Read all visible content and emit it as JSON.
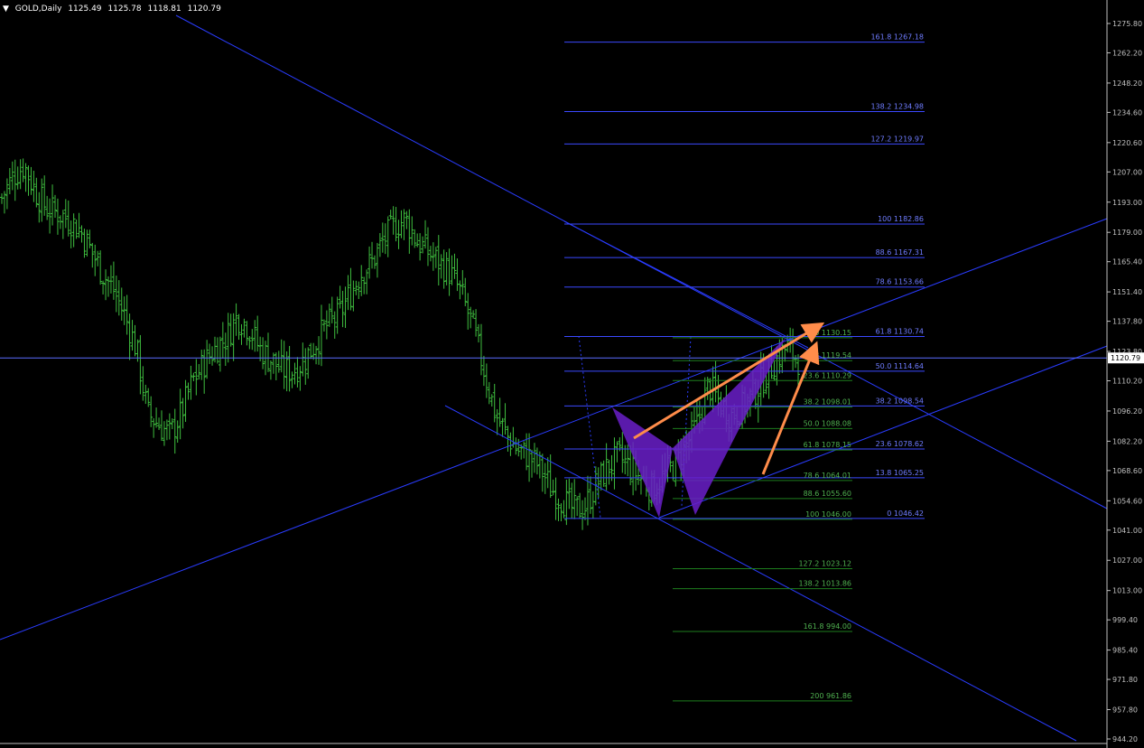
{
  "header": {
    "symbol": "GOLD,Daily",
    "open": "1125.49",
    "high": "1125.78",
    "low": "1118.81",
    "close": "1120.79",
    "caret_icon": "triangle-down-icon"
  },
  "colors": {
    "background": "#000000",
    "bar": "#3fbf3f",
    "trendline": "#2a3cff",
    "fib_blue": "#3b49ff",
    "fib_green": "#1e7e1e",
    "pattern_fill": "#6a1fc9",
    "arrow": "#ff8c4a",
    "axis": "#c0c0c0",
    "price_tag_bg": "#ffffff"
  },
  "chart_data": {
    "type": "ohlc",
    "instrument": "GOLD",
    "timeframe": "Daily",
    "ylim": [
      944.2,
      1282.0
    ],
    "y_ticks": [
      "1275.80",
      "1262.20",
      "1248.20",
      "1234.60",
      "1220.60",
      "1207.00",
      "1193.00",
      "1179.00",
      "1165.40",
      "1151.40",
      "1137.80",
      "1123.80",
      "1110.20",
      "1096.20",
      "1082.20",
      "1068.60",
      "1054.60",
      "1041.00",
      "1027.00",
      "1013.00",
      "999.40",
      "985.40",
      "971.80",
      "957.80",
      "944.20"
    ],
    "current_price": "1120.79",
    "close_path": [
      1195,
      1205,
      1210,
      1198,
      1190,
      1188,
      1185,
      1180,
      1170,
      1160,
      1152,
      1140,
      1125,
      1095,
      1090,
      1085,
      1095,
      1110,
      1118,
      1125,
      1130,
      1140,
      1135,
      1125,
      1120,
      1115,
      1115,
      1120,
      1128,
      1136,
      1140,
      1150,
      1160,
      1165,
      1175,
      1182,
      1185,
      1175,
      1170,
      1165,
      1160,
      1150,
      1135,
      1115,
      1095,
      1085,
      1078,
      1075,
      1070,
      1060,
      1055,
      1050,
      1052,
      1062,
      1070,
      1075,
      1070,
      1065,
      1060,
      1066,
      1072,
      1080,
      1090,
      1108,
      1100,
      1094,
      1098,
      1104,
      1112,
      1120,
      1126,
      1120
    ],
    "fib_blue_levels": [
      {
        "label": "161.8 1267.18",
        "value": 1267.18
      },
      {
        "label": "138.2 1234.98",
        "value": 1234.98
      },
      {
        "label": "127.2 1219.97",
        "value": 1219.97
      },
      {
        "label": "100 1182.86",
        "value": 1182.86
      },
      {
        "label": "88.6 1167.31",
        "value": 1167.31
      },
      {
        "label": "78.6 1153.66",
        "value": 1153.66
      },
      {
        "label": "61.8 1130.74",
        "value": 1130.74
      },
      {
        "label": "50.0 1114.64",
        "value": 1114.64
      },
      {
        "label": "38.2 1098.54",
        "value": 1098.54
      },
      {
        "label": "23.6 1078.62",
        "value": 1078.62
      },
      {
        "label": "13.8 1065.25",
        "value": 1065.25
      },
      {
        "label": "0 1046.42",
        "value": 1046.42
      }
    ],
    "fib_green_levels": [
      {
        "label": "0.0 1130.15",
        "value": 1130.15
      },
      {
        "label": "13.8 1119.54",
        "value": 1119.54
      },
      {
        "label": "23.6 1110.29",
        "value": 1110.29
      },
      {
        "label": "38.2 1098.01",
        "value": 1098.01
      },
      {
        "label": "50.0 1088.08",
        "value": 1088.08
      },
      {
        "label": "61.8 1078.15",
        "value": 1078.15
      },
      {
        "label": "78.6 1064.01",
        "value": 1064.01
      },
      {
        "label": "88.6 1055.60",
        "value": 1055.6
      },
      {
        "label": "100 1046.00",
        "value": 1046.0
      },
      {
        "label": "127.2 1023.12",
        "value": 1023.12
      },
      {
        "label": "138.2 1013.86",
        "value": 1013.86
      },
      {
        "label": "161.8 994.00",
        "value": 994.0
      },
      {
        "label": "200 961.86",
        "value": 961.86
      }
    ],
    "annotations": [
      "butterfly pattern",
      "two upward arrows"
    ]
  }
}
